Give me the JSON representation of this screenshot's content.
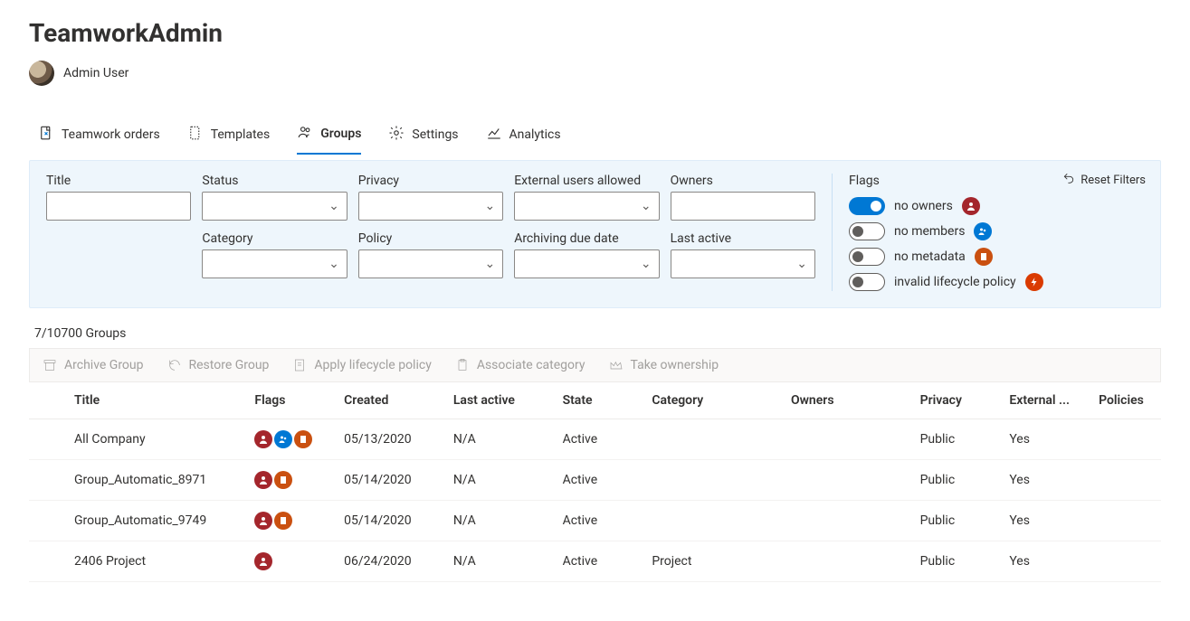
{
  "header": {
    "title": "TeamworkAdmin",
    "user": "Admin User"
  },
  "tabs": [
    {
      "label": "Teamwork orders"
    },
    {
      "label": "Templates"
    },
    {
      "label": "Groups",
      "selected": true
    },
    {
      "label": "Settings"
    },
    {
      "label": "Analytics"
    }
  ],
  "filters": {
    "labels": {
      "title": "Title",
      "status": "Status",
      "privacy": "Privacy",
      "external_users": "External users allowed",
      "owners": "Owners",
      "category": "Category",
      "policy": "Policy",
      "archiving_due": "Archiving due date",
      "last_active": "Last active"
    },
    "flags_title": "Flags",
    "flags": [
      {
        "label": "no owners",
        "on": true,
        "badge": "red"
      },
      {
        "label": "no members",
        "on": false,
        "badge": "blue"
      },
      {
        "label": "no metadata",
        "on": false,
        "badge": "orange"
      },
      {
        "label": "invalid lifecycle policy",
        "on": false,
        "badge": "orangelt"
      }
    ],
    "reset": "Reset Filters"
  },
  "count_label": "7/10700 Groups",
  "actions": {
    "archive": "Archive Group",
    "restore": "Restore Group",
    "apply_policy": "Apply lifecycle policy",
    "associate": "Associate category",
    "take_ownership": "Take ownership"
  },
  "table": {
    "columns": {
      "title": "Title",
      "flags": "Flags",
      "created": "Created",
      "last_active": "Last active",
      "state": "State",
      "category": "Category",
      "owners": "Owners",
      "privacy": "Privacy",
      "external": "External ...",
      "policies": "Policies"
    },
    "rows": [
      {
        "title": "All Company",
        "flags": [
          "red",
          "blue",
          "orange"
        ],
        "created": "05/13/2020",
        "last_active": "N/A",
        "state": "Active",
        "category": "",
        "owners": "",
        "privacy": "Public",
        "external": "Yes",
        "policies": ""
      },
      {
        "title": "Group_Automatic_8971",
        "flags": [
          "red",
          "orange"
        ],
        "created": "05/14/2020",
        "last_active": "N/A",
        "state": "Active",
        "category": "",
        "owners": "",
        "privacy": "Public",
        "external": "Yes",
        "policies": ""
      },
      {
        "title": "Group_Automatic_9749",
        "flags": [
          "red",
          "orange"
        ],
        "created": "05/14/2020",
        "last_active": "N/A",
        "state": "Active",
        "category": "",
        "owners": "",
        "privacy": "Public",
        "external": "Yes",
        "policies": ""
      },
      {
        "title": "2406 Project",
        "flags": [
          "red"
        ],
        "created": "06/24/2020",
        "last_active": "N/A",
        "state": "Active",
        "category": "Project",
        "owners": "",
        "privacy": "Public",
        "external": "Yes",
        "policies": ""
      }
    ]
  }
}
